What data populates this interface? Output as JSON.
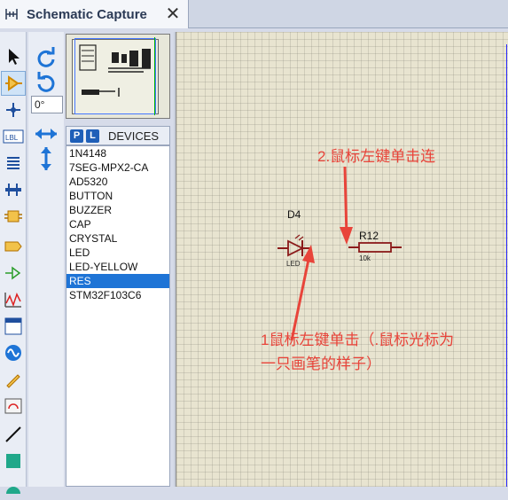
{
  "tab": {
    "title": "Schematic Capture",
    "icon": "schematic-icon",
    "close_icon": "close-icon"
  },
  "orientation": {
    "angle": "0°"
  },
  "devices": {
    "header": "DEVICES",
    "p_label": "P",
    "l_label": "L",
    "items": [
      "1N4148",
      "7SEG-MPX2-CA",
      "AD5320",
      "BUTTON",
      "BUZZER",
      "CAP",
      "CRYSTAL",
      "LED",
      "LED-YELLOW",
      "RES",
      "STM32F103C6"
    ],
    "selected": "RES"
  },
  "canvas": {
    "led": {
      "ref": "D4",
      "value": "LED"
    },
    "resistor": {
      "ref": "R12",
      "value": "10k"
    },
    "annotations": {
      "note_top": "2.鼠标左键单击连",
      "note_bottom_line1": "1鼠标左键单击（.鼠标光标为",
      "note_bottom_line2": "一只画笔的样子）"
    },
    "annotation_color": "#e8443a"
  },
  "colors": {
    "accent": "#1e74d6",
    "sheet": "#e8e4d0"
  }
}
